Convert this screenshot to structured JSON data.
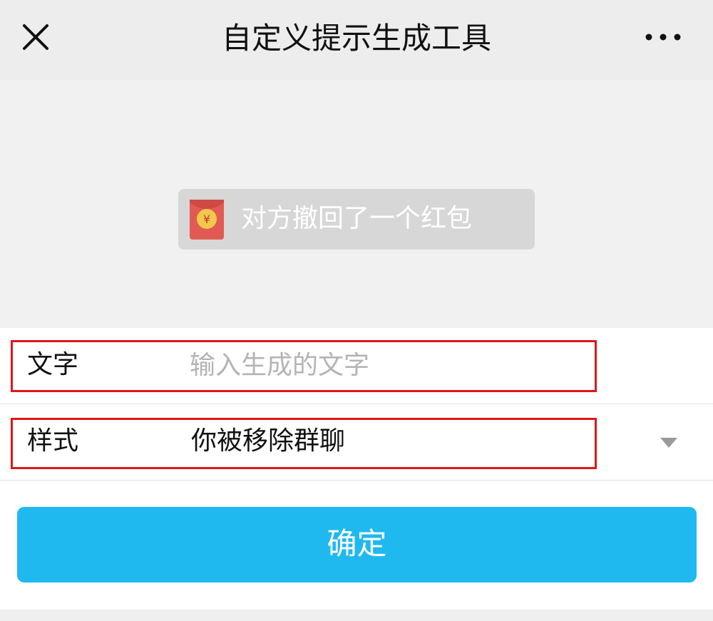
{
  "header": {
    "title": "自定义提示生成工具",
    "close_icon": "close-icon",
    "more_icon": "more-icon"
  },
  "preview": {
    "notice_text": "对方撤回了一个红包",
    "envelope_icon": "red-envelope-icon",
    "envelope_symbol": "¥"
  },
  "form": {
    "text_row": {
      "label": "文字",
      "value": "",
      "placeholder": "输入生成的文字"
    },
    "style_row": {
      "label": "样式",
      "selected": "你被移除群聊",
      "dropdown_icon": "chevron-down-icon"
    }
  },
  "confirm": {
    "label": "确定"
  },
  "colors": {
    "accent": "#1fb9f0",
    "highlight_border": "#e0161b",
    "envelope": "#e15b54",
    "coin": "#f2c84b"
  }
}
